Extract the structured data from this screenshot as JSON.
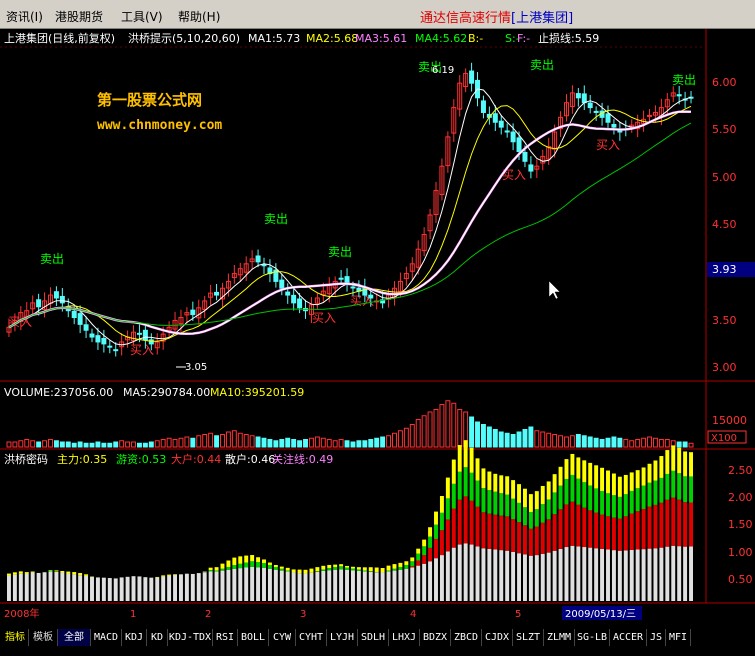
{
  "menu": {
    "items": [
      "资讯(I)",
      "港股期货",
      "工具(V)",
      "帮助(H)"
    ],
    "title_prefix": "通达信高速行情",
    "title_stock": "[上港集团]"
  },
  "header": {
    "stock": "上港集团(日线,前复权)",
    "indicator": "洪桥提示(5,10,20,60)",
    "ma1": "MA1:5.73",
    "ma2": "MA2:5.68",
    "ma3": "MA3:5.61",
    "ma4": "MA4:5.62",
    "b": "B:-",
    "s": "S:-",
    "f": "F:-",
    "stop": "止损线:5.59"
  },
  "watermark": {
    "line1": "第一股票公式网",
    "line2": "www.chnmoney.com"
  },
  "volume_header": {
    "vol": "VOLUME:237056.00",
    "ma5": "MA5:290784.00",
    "ma10": "MA10:395201.59"
  },
  "capital_header": {
    "name": "洪桥密码",
    "a": "主力:0.35",
    "b": "游资:0.53",
    "c": "大户:0.44",
    "d": "散户:0.46",
    "e": "关注线:0.49"
  },
  "price_axis": [
    "6.00",
    "5.50",
    "5.00",
    "4.50",
    "4.00",
    "3.50",
    "3.00"
  ],
  "price_current": "3.93",
  "volume_axis": [
    "15000"
  ],
  "volume_unit": "X100",
  "capital_axis": [
    "2.50",
    "2.00",
    "1.50",
    "1.00",
    "0.50"
  ],
  "time_labels": [
    "2008年",
    "1",
    "2",
    "3",
    "4",
    "5"
  ],
  "date_label": "2009/05/13/三",
  "annotations": {
    "sell": "卖出",
    "buy": "买入",
    "high": "6.19",
    "low": "3.05"
  },
  "tabs": [
    "指标",
    "模板",
    "全部",
    "MACD",
    "KDJ",
    "KD",
    "KDJ-TDX",
    "RSI",
    "BOLL",
    "CYW",
    "CYHT",
    "LYJH",
    "SDLH",
    "LHXJ",
    "BDZX",
    "ZBCD",
    "CJDX",
    "SLZT",
    "ZLMM",
    "SG-LB",
    "ACCER",
    "JS",
    "MFI"
  ],
  "colors": {
    "up": "#ff3232",
    "down": "#54fcfc",
    "ma_white": "#ffffff",
    "ma_yellow": "#ffff00",
    "ma_pink": "#ff80ff",
    "ma_green": "#00c000",
    "axis": "#b00000"
  },
  "chart_data": {
    "type": "candlestick",
    "series": [
      {
        "name": "price",
        "closes": [
          3.45,
          3.52,
          3.6,
          3.62,
          3.7,
          3.66,
          3.72,
          3.78,
          3.75,
          3.7,
          3.62,
          3.55,
          3.48,
          3.42,
          3.35,
          3.3,
          3.28,
          3.25,
          3.22,
          3.3,
          3.35,
          3.4,
          3.38,
          3.32,
          3.28,
          3.3,
          3.38,
          3.45,
          3.52,
          3.55,
          3.6,
          3.58,
          3.65,
          3.72,
          3.8,
          3.78,
          3.85,
          3.92,
          4.0,
          4.05,
          4.1,
          4.15,
          4.12,
          4.08,
          4.0,
          3.92,
          3.85,
          3.78,
          3.7,
          3.65,
          3.62,
          3.68,
          3.75,
          3.82,
          3.88,
          3.92,
          3.95,
          3.9,
          3.86,
          3.82,
          3.78,
          3.75,
          3.72,
          3.7,
          3.78,
          3.85,
          3.92,
          4.0,
          4.1,
          4.25,
          4.4,
          4.6,
          4.85,
          5.1,
          5.4,
          5.7,
          5.95,
          6.05,
          5.95,
          5.8,
          5.65,
          5.6,
          5.55,
          5.5,
          5.45,
          5.35,
          5.25,
          5.15,
          5.05,
          5.1,
          5.2,
          5.3,
          5.45,
          5.6,
          5.75,
          5.85,
          5.8,
          5.75,
          5.7,
          5.65,
          5.6,
          5.55,
          5.5,
          5.45,
          5.48,
          5.52,
          5.55,
          5.58,
          5.62,
          5.65,
          5.7,
          5.78,
          5.85,
          5.82,
          5.78,
          5.8
        ]
      },
      {
        "name": "volume",
        "values": [
          4,
          4,
          5,
          6,
          5,
          4,
          5,
          6,
          5,
          4,
          4,
          3,
          4,
          3,
          3,
          4,
          3,
          3,
          4,
          5,
          4,
          4,
          3,
          3,
          4,
          5,
          6,
          7,
          6,
          7,
          8,
          7,
          9,
          10,
          11,
          9,
          10,
          12,
          13,
          11,
          10,
          9,
          8,
          7,
          6,
          5,
          6,
          7,
          6,
          5,
          6,
          7,
          8,
          7,
          6,
          5,
          6,
          5,
          4,
          5,
          5,
          6,
          7,
          8,
          9,
          11,
          13,
          15,
          18,
          22,
          25,
          28,
          30,
          34,
          37,
          35,
          30,
          28,
          24,
          20,
          18,
          16,
          14,
          12,
          11,
          10,
          12,
          14,
          16,
          13,
          12,
          11,
          10,
          9,
          8,
          9,
          10,
          9,
          8,
          7,
          6,
          7,
          8,
          7,
          6,
          5,
          6,
          7,
          8,
          7,
          6,
          6,
          5,
          4,
          4,
          3
        ]
      }
    ],
    "ylim_price": [
      2.9,
      6.3
    ],
    "ylim_capital": [
      0,
      2.7
    ]
  }
}
